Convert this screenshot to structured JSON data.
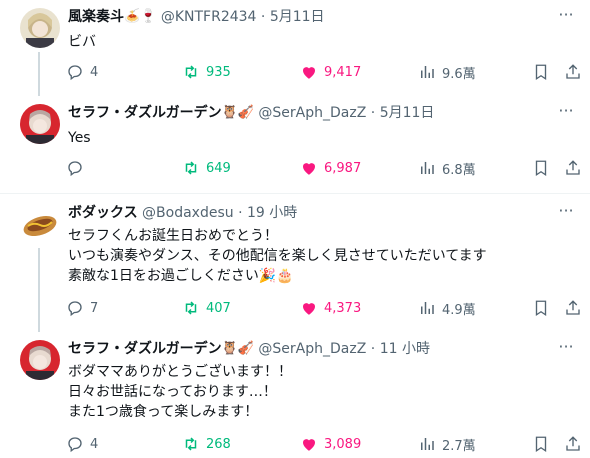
{
  "tweets": [
    {
      "name": "風楽奏斗",
      "emoji": "🍝🍷",
      "handle": "@KNTFR2434",
      "dot": "·",
      "time": "5月11日",
      "text": "ビバ",
      "replies": "4",
      "retweets": "935",
      "likes": "9,417",
      "views": "9.6萬"
    },
    {
      "name": "セラフ・ダズルガーデン",
      "emoji": "🦉🎻",
      "handle": "@SerAph_DazZ",
      "dot": "·",
      "time": "5月11日",
      "text": "Yes",
      "replies": "",
      "retweets": "649",
      "likes": "6,987",
      "views": "6.8萬"
    },
    {
      "name": "ボダックス",
      "emoji": "",
      "handle": "@Bodaxdesu",
      "dot": "·",
      "time": "19 小時",
      "text": "セラフくんお誕生日おめでとう！\nいつも演奏やダンス、その他配信を楽しく見させていただいてます\n素敵な1日をお過ごしください🎉🎂",
      "replies": "7",
      "retweets": "407",
      "likes": "4,373",
      "views": "4.9萬"
    },
    {
      "name": "セラフ・ダズルガーデン",
      "emoji": "🦉🎻",
      "handle": "@SerAph_DazZ",
      "dot": "·",
      "time": "11 小時",
      "text": "ボダママありがとうございます！！\n日々お世話になっております…！\nまた1つ歳食って楽しみます！",
      "replies": "4",
      "retweets": "268",
      "likes": "3,089",
      "views": "2.7萬"
    }
  ],
  "colors": {
    "text": "#0f1419",
    "muted": "#536471",
    "retweet": "#00ba7c",
    "like": "#f91880",
    "separator": "#eff3f4",
    "thread_line": "#cfd9de"
  }
}
